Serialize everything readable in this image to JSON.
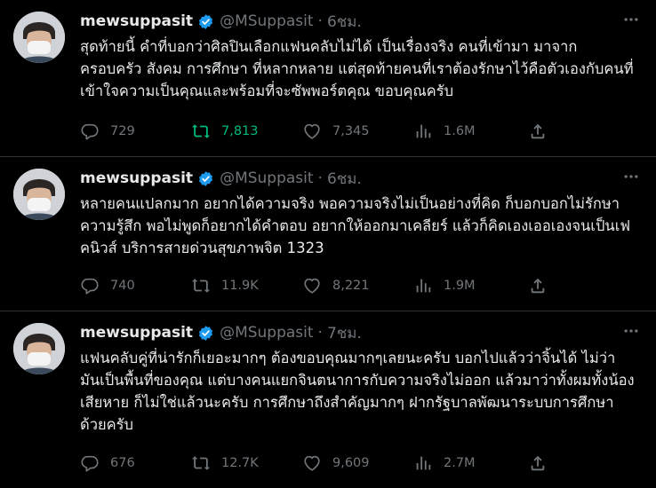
{
  "colors": {
    "background": "#000000",
    "text": "#e7e9ea",
    "muted": "#71767b",
    "verified": "#1d9bf0",
    "retweet_active": "#00ba7c",
    "divider": "#2f3336"
  },
  "icons": {
    "verified": "verified-badge-icon",
    "more": "more-dots-icon",
    "reply": "reply-icon",
    "retweet": "retweet-icon",
    "like": "heart-icon",
    "views": "views-chart-icon",
    "share": "share-icon"
  },
  "tweets": [
    {
      "name": "mewsuppasit",
      "handle": "@MSuppasit",
      "dot": "·",
      "time": "6ชม.",
      "text": "สุดท้ายนี้ คำที่บอกว่าศิลปินเลือกแฟนคลับไม่ได้ เป็นเรื่องจริง คนที่เข้ามา มาจากครอบครัว สังคม การศึกษา ที่หลากหลาย แต่สุดท้ายคนที่เราต้องรักษาไว้คือตัวเองกับคนที่เข้าใจความเป็นคุณและพร้อมที่จะซัพพอร์ตคุณ ขอบคุณครับ",
      "replies": "729",
      "retweets": "7,813",
      "likes": "7,345",
      "views": "1.6M",
      "retweeted": true
    },
    {
      "name": "mewsuppasit",
      "handle": "@MSuppasit",
      "dot": "·",
      "time": "6ชม.",
      "text": "หลายคนแปลกมาก อยากได้ความจริง พอความจริงไม่เป็นอย่างที่คิด ก็บอกบอกไม่รักษาความรู้สึก พอไม่พูดก็อยากได้คำตอบ อยากให้ออกมาเคลียร์ แล้วก็คิดเองเออเองจนเป็นเฟคนิวส์ บริการสายด่วนสุขภาพจิต 1323",
      "replies": "740",
      "retweets": "11.9K",
      "likes": "8,221",
      "views": "1.9M",
      "retweeted": false
    },
    {
      "name": "mewsuppasit",
      "handle": "@MSuppasit",
      "dot": "·",
      "time": "7ชม.",
      "text": "แฟนคลับคู่ที่น่ารักก็เยอะมากๆ ต้องขอบคุณมากๆเลยนะครับ บอกไปแล้วว่าจิ้นได้ ไม่ว่า มันเป็นพื้นที่ของคุณ แต่บางคนแยกจินตนาการกับความจริงไม่ออก แล้วมาว่าทั้งผมทั้งน้องเสียหาย ก็ไม่ใช่แล้วนะครับ การศึกษาถึงสำคัญมากๆ ฝากรัฐบาลพัฒนาระบบการศึกษาด้วยครับ",
      "replies": "676",
      "retweets": "12.7K",
      "likes": "9,609",
      "views": "2.7M",
      "retweeted": false
    }
  ]
}
